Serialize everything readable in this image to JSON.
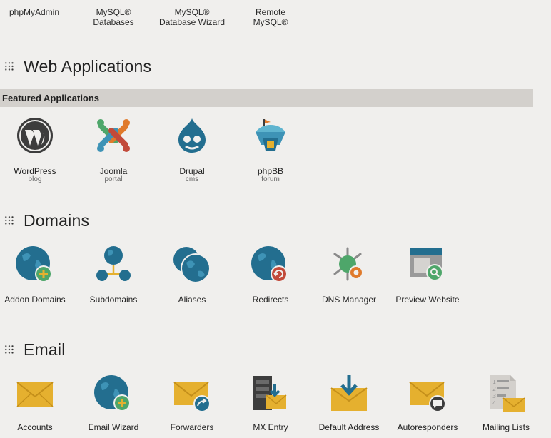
{
  "databases": {
    "items": [
      {
        "label": "phpMyAdmin"
      },
      {
        "label": "MySQL®\nDatabases"
      },
      {
        "label": "MySQL®\nDatabase Wizard"
      },
      {
        "label": "Remote\nMySQL®"
      }
    ]
  },
  "web_apps": {
    "title": "Web Applications",
    "featured_label": "Featured Applications",
    "apps": [
      {
        "label": "WordPress",
        "sub": "blog",
        "icon": "wordpress-icon"
      },
      {
        "label": "Joomla",
        "sub": "portal",
        "icon": "joomla-icon"
      },
      {
        "label": "Drupal",
        "sub": "cms",
        "icon": "drupal-icon"
      },
      {
        "label": "phpBB",
        "sub": "forum",
        "icon": "phpbb-icon"
      }
    ]
  },
  "domains": {
    "title": "Domains",
    "items": [
      {
        "label": "Addon Domains",
        "icon": "globe-plus-icon"
      },
      {
        "label": "Subdomains",
        "icon": "subdomains-icon"
      },
      {
        "label": "Aliases",
        "icon": "aliases-icon"
      },
      {
        "label": "Redirects",
        "icon": "globe-redirect-icon"
      },
      {
        "label": "DNS Manager",
        "icon": "dns-manager-icon"
      },
      {
        "label": "Preview Website",
        "icon": "preview-website-icon"
      }
    ]
  },
  "email": {
    "title": "Email",
    "items": [
      {
        "label": "Accounts",
        "icon": "envelope-icon"
      },
      {
        "label": "Email Wizard",
        "icon": "globe-plus-icon"
      },
      {
        "label": "Forwarders",
        "icon": "envelope-forward-icon"
      },
      {
        "label": "MX Entry",
        "icon": "mx-entry-icon"
      },
      {
        "label": "Default Address",
        "icon": "envelope-download-icon"
      },
      {
        "label": "Autoresponders",
        "icon": "envelope-chat-icon"
      },
      {
        "label": "Mailing Lists",
        "icon": "mailing-lists-icon"
      }
    ]
  },
  "colors": {
    "teal": "#236e8f",
    "teal_light": "#3e93b6",
    "green": "#4ea66a",
    "orange": "#e07a2b",
    "yellow": "#e5b02f",
    "gray_dark": "#3d3d3d",
    "bar_bg": "#d3d0cc",
    "page_bg": "#f0efed"
  }
}
